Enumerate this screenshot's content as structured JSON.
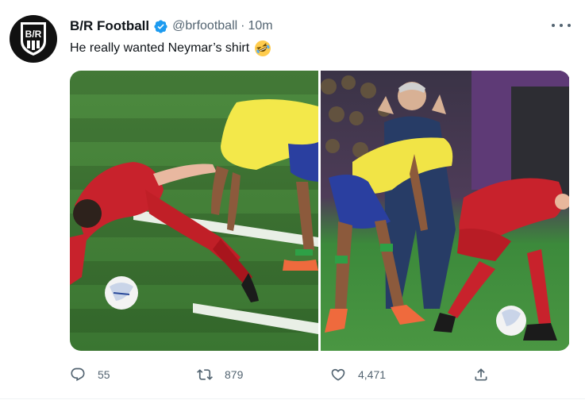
{
  "tweet": {
    "avatar": {
      "text": "B/R",
      "icon": "br-logo-icon"
    },
    "display_name": "B/R Football",
    "verified_icon": "verified-badge-icon",
    "handle": "@brfootball",
    "separator": "·",
    "time": "10m",
    "text": "He really wanted Neymar’s shirt",
    "emoji": "rolling-on-the-floor-laughing-emoji",
    "more_icon": "more-options-icon",
    "media": [
      {
        "name": "photo-1"
      },
      {
        "name": "photo-2"
      }
    ],
    "actions": {
      "reply": {
        "icon": "reply-icon",
        "count": "55"
      },
      "retweet": {
        "icon": "retweet-icon",
        "count": "879"
      },
      "like": {
        "icon": "heart-icon",
        "count": "4,471"
      },
      "share": {
        "icon": "share-icon"
      }
    }
  },
  "colors": {
    "text": "#0f1419",
    "secondary": "#536471",
    "verified": "#1d9bf0",
    "divider": "#eff3f4"
  }
}
